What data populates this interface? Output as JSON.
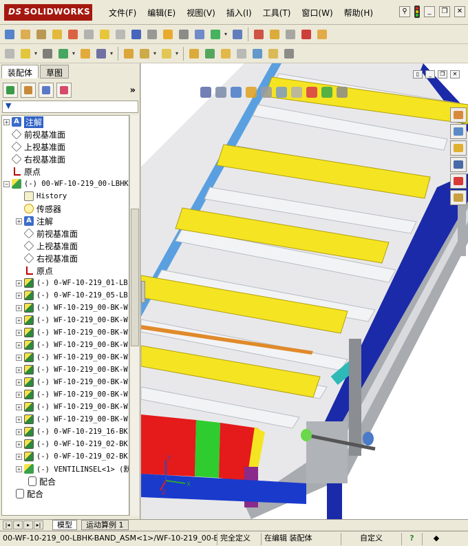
{
  "app": {
    "logo_text": "SOLIDWORKS",
    "logo_prefix": "DS"
  },
  "menu": [
    {
      "label": "文件(F)"
    },
    {
      "label": "编辑(E)"
    },
    {
      "label": "视图(V)"
    },
    {
      "label": "插入(I)"
    },
    {
      "label": "工具(T)"
    },
    {
      "label": "窗口(W)"
    },
    {
      "label": "帮助(H)"
    }
  ],
  "panel": {
    "tabs": [
      "装配体",
      "草图"
    ],
    "filter_symbol": "▼",
    "more_symbol": "»"
  },
  "tree": {
    "rows": [
      {
        "label": "注解",
        "selected": true
      },
      {
        "label": "前视基准面"
      },
      {
        "label": "上视基准面"
      },
      {
        "label": "右视基准面"
      },
      {
        "label": "原点"
      },
      {
        "label": "(-) 00-WF-10-219_00-LBHK"
      },
      {
        "label": "History"
      },
      {
        "label": "传感器"
      },
      {
        "label": "注解"
      },
      {
        "label": "前视基准面"
      },
      {
        "label": "上视基准面"
      },
      {
        "label": "右视基准面"
      },
      {
        "label": "原点"
      },
      {
        "label": "(-) 0-WF-10-219_01-LB"
      },
      {
        "label": "(-) 0-WF-10-219_05-LB"
      },
      {
        "label": "(-) WF-10-219_00-BK-W"
      },
      {
        "label": "(-) WF-10-219_00-BK-W"
      },
      {
        "label": "(-) WF-10-219_00-BK-W"
      },
      {
        "label": "(-) WF-10-219_00-BK-W"
      },
      {
        "label": "(-) WF-10-219_00-BK-W"
      },
      {
        "label": "(-) WF-10-219_00-BK-W"
      },
      {
        "label": "(-) WF-10-219_00-BK-W"
      },
      {
        "label": "(-) WF-10-219_00-BK-W"
      },
      {
        "label": "(-) WF-10-219_00-BK-W"
      },
      {
        "label": "(-) WF-10-219_00-BK-W"
      },
      {
        "label": "(-) 0-WF-10-219_16-BK"
      },
      {
        "label": "(-) 0-WF-10-219_02-BK"
      },
      {
        "label": "(-) 0-WF-10-219_02-BK"
      },
      {
        "label": "(-) VENTILINSEL<1> (默"
      },
      {
        "label": "配合"
      },
      {
        "label": "配合"
      }
    ]
  },
  "bottom_tabs": {
    "model": "模型",
    "motion": "运动算例 1"
  },
  "status": {
    "path": "00-WF-10-219_00-LBHK-BAND_ASM<1>/WF-10-219_00-B...",
    "defined": "完全定义",
    "editing": "在编辑 装配体",
    "custom": "自定义",
    "help_symbol": "?"
  },
  "triad": {
    "x": "X",
    "y": "Y",
    "z": "Z"
  }
}
